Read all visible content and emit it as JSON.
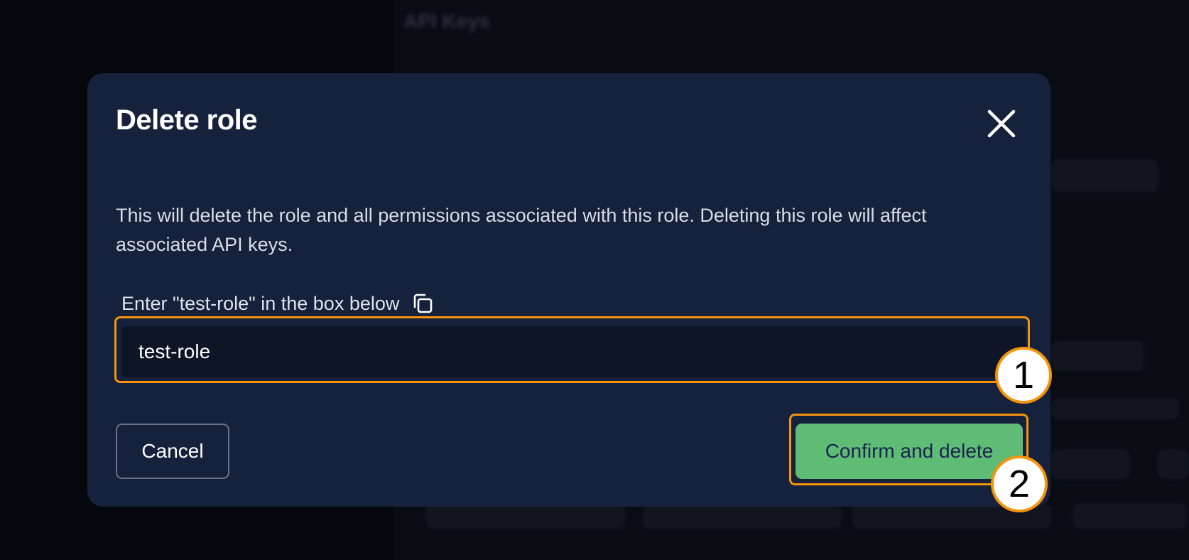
{
  "background": {
    "page_title": "API Keys"
  },
  "dialog": {
    "title": "Delete role",
    "description": "This will delete the role and all permissions associated with this role. Deleting this role will affect associated API keys.",
    "input_label": "Enter \"test-role\" in the box below",
    "input_value": "test-role",
    "cancel_label": "Cancel",
    "confirm_label": "Confirm and delete"
  },
  "callouts": [
    "1",
    "2"
  ],
  "colors": {
    "modal_bg": "#16213b",
    "highlight": "#f5940c",
    "confirm_bg": "#5fbc74",
    "confirm_text": "#1b2350"
  },
  "icons": {
    "close": "close-icon",
    "copy": "copy-icon"
  }
}
